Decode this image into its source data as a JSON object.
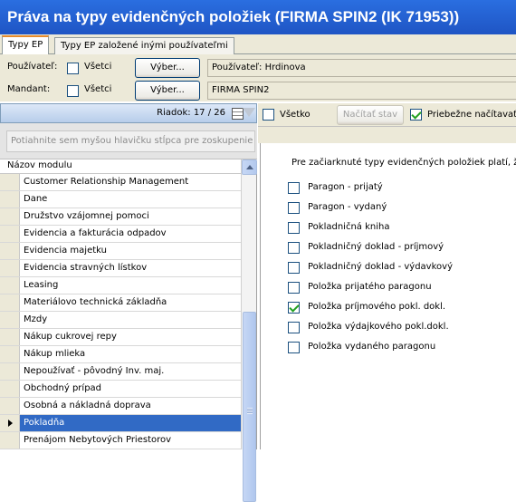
{
  "window": {
    "title": "Práva na typy evidenčných položiek (FIRMA SPIN2 (IK 71953))"
  },
  "tabs": [
    "Typy EP",
    "Typy EP založené inými používateľmi"
  ],
  "filters": {
    "user": {
      "label": "Používateľ:",
      "all_label": "Všetci",
      "all_checked": false,
      "button": "Výber...",
      "value": "Používateľ: Hrdinova"
    },
    "mandant": {
      "label": "Mandant:",
      "all_label": "Všetci",
      "all_checked": false,
      "button": "Výber...",
      "value": "FIRMA SPIN2"
    }
  },
  "grid": {
    "row_indicator": "Riadok: 17 / 26",
    "group_placeholder": "Potiahnite sem myšou hlavičku stĺpca pre zoskupenie",
    "column_header": "Názov modulu",
    "rows": [
      "Customer Relationship Management",
      "Dane",
      "Družstvo vzájomnej pomoci",
      "Evidencia a fakturácia odpadov",
      "Evidencia majetku",
      "Evidencia stravných lístkov",
      "Leasing",
      "Materiálovo technická základňa",
      "Mzdy",
      "Nákup cukrovej repy",
      "Nákup mlieka",
      "Nepoužívať - pôvodný Inv. maj.",
      "Obchodný prípad",
      "Osobná a nákladná doprava",
      "Pokladňa",
      "Prenájom Nebytových Priestorov"
    ],
    "selected_row": "Pokladňa"
  },
  "right": {
    "toolbar": {
      "all_label": "Všetko",
      "all_checked": false,
      "load_button": "Načítať stav",
      "continuous_label": "Priebežne načítavať",
      "continuous_checked": true
    },
    "description": "Pre začiarknuté typy evidenčných položiek platí, že",
    "options": [
      {
        "label": "Paragon - prijatý",
        "checked": false
      },
      {
        "label": "Paragon - vydaný",
        "checked": false
      },
      {
        "label": "Pokladničná kniha",
        "checked": false
      },
      {
        "label": "Pokladničný doklad - príjmový",
        "checked": false
      },
      {
        "label": "Pokladničný doklad - výdavkový",
        "checked": false
      },
      {
        "label": "Položka prijatého paragonu",
        "checked": false
      },
      {
        "label": "Položka príjmového pokl. dokl.",
        "checked": true
      },
      {
        "label": "Položka výdajkového pokl.dokl.",
        "checked": false
      },
      {
        "label": "Položka vydaného paragonu",
        "checked": false
      }
    ]
  },
  "colors": {
    "title_bar": "#2163d6",
    "selection": "#316ac5",
    "panel": "#ece9d8"
  }
}
